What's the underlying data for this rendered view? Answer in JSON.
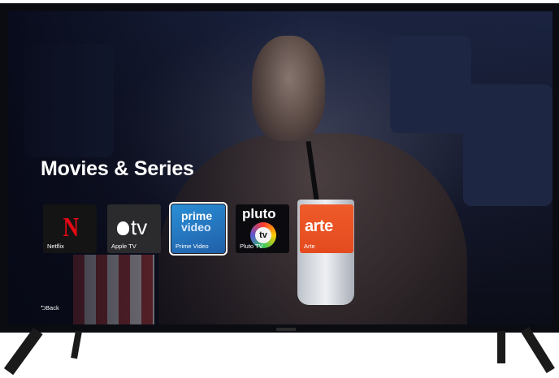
{
  "screen": {
    "section_title": "Movies & Series",
    "apps": [
      {
        "label": "Netflix",
        "logo_text": "N",
        "icon": "netflix-logo",
        "bg": "#141414"
      },
      {
        "label": "Apple TV",
        "logo_text": "tv",
        "icon": "apple-tv-logo",
        "bg": "#2b2b2e"
      },
      {
        "label": "Prime Video",
        "logo_text_1": "prime",
        "logo_text_2": "video",
        "icon": "prime-video-logo",
        "bg": "#1f5fa8",
        "selected": true
      },
      {
        "label": "Pluto TV",
        "logo_text_1": "pluto",
        "logo_text_2": "tv",
        "icon": "pluto-tv-logo",
        "bg": "#0b0b0f"
      },
      {
        "label": "Arte",
        "logo_text": "arte",
        "icon": "arte-logo",
        "bg": "#e34b1f"
      }
    ],
    "back_label": "Back",
    "back_icon": "back-arrow-icon"
  }
}
